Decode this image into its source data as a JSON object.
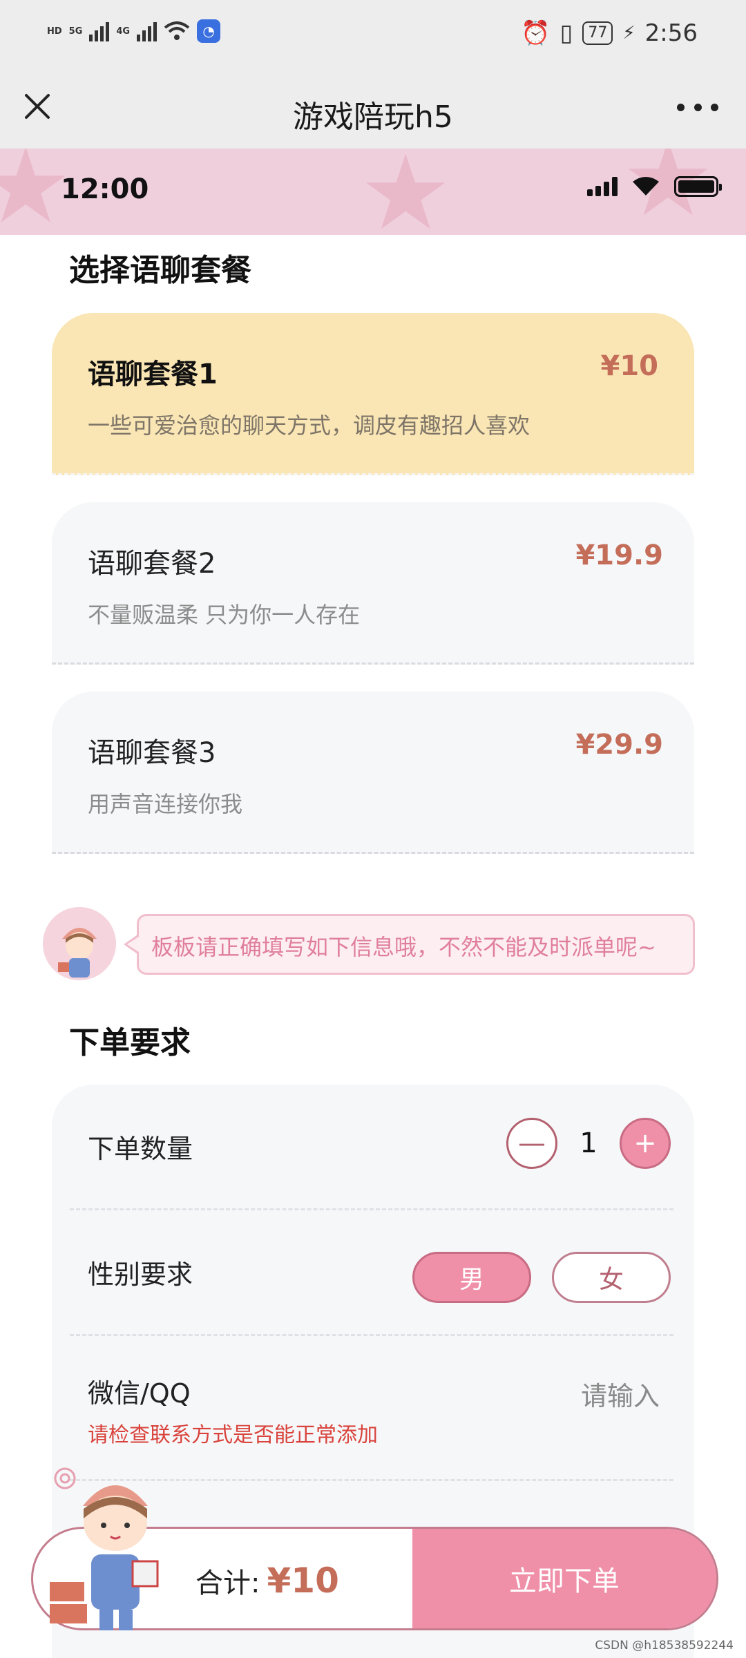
{
  "system_bar": {
    "left_labels": [
      "HD",
      "5G",
      "4G"
    ],
    "battery": "77",
    "time": "2:56"
  },
  "titlebar": {
    "title": "游戏陪玩h5"
  },
  "app_status": {
    "time": "12:00"
  },
  "package_section": {
    "title": "选择语聊套餐",
    "packages": [
      {
        "name": "语聊套餐1",
        "price": "¥10",
        "desc": "一些可爱治愈的聊天方式，调皮有趣招人喜欢",
        "selected": true
      },
      {
        "name": "语聊套餐2",
        "price": "¥19.9",
        "desc": "不量贩温柔 只为你一人存在",
        "selected": false
      },
      {
        "name": "语聊套餐3",
        "price": "¥29.9",
        "desc": "用声音连接你我",
        "selected": false
      }
    ]
  },
  "tip": {
    "text": "板板请正确填写如下信息哦，不然不能及时派单呢~"
  },
  "order_section": {
    "title": "下单要求",
    "quantity": {
      "label": "下单数量",
      "value": "1",
      "minus": "—",
      "plus": "+"
    },
    "gender": {
      "label": "性别要求",
      "options": [
        "男",
        "女"
      ],
      "selected": "男"
    },
    "contact": {
      "label": "微信/QQ",
      "placeholder": "请输入",
      "warning": "请检查联系方式是否能正常添加"
    }
  },
  "bottom": {
    "total_label": "合计:",
    "total_value": "¥10",
    "submit": "立即下单"
  },
  "watermark": "CSDN @h18538592244",
  "colors": {
    "accent_pink": "#ef8fa8",
    "price": "#c46e5a",
    "selected_card": "#fae6b4",
    "header_pink": "#f0cfdc",
    "warning": "#d9433c"
  }
}
